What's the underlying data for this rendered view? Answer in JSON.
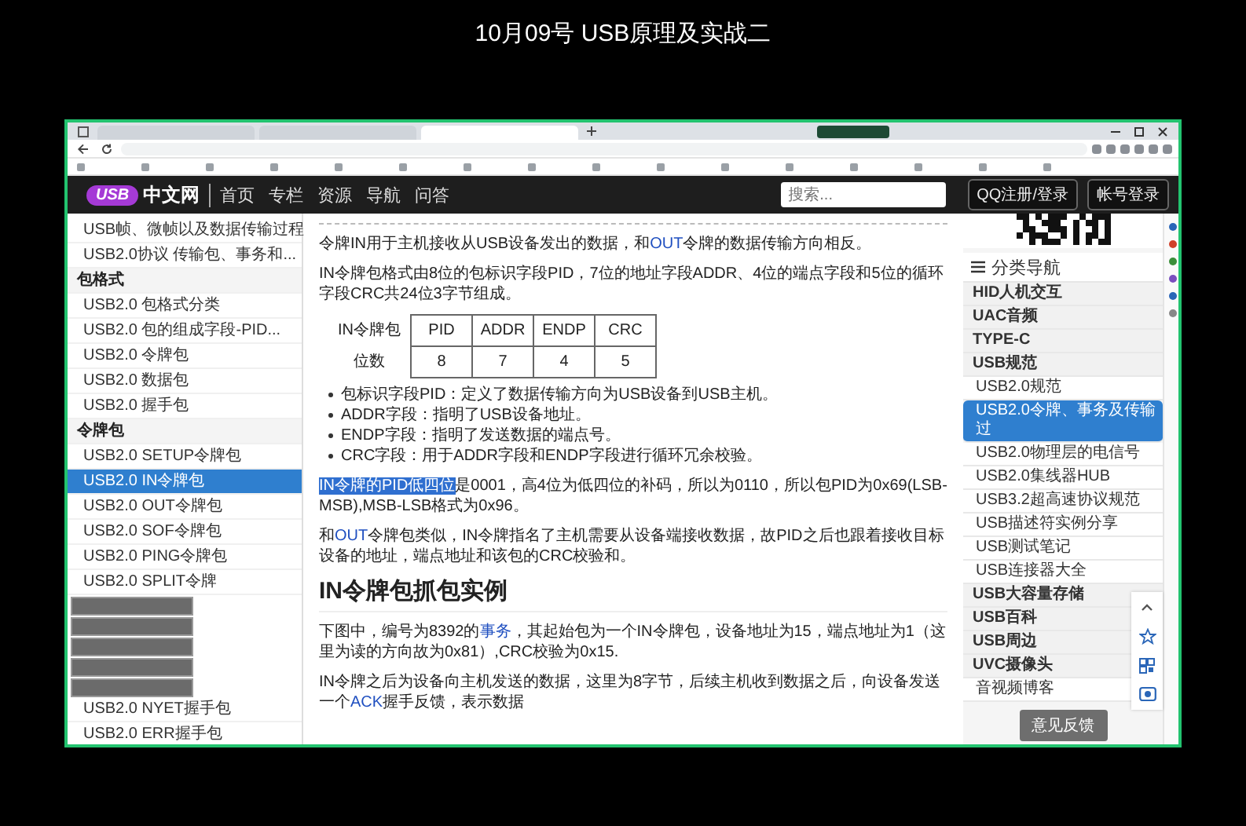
{
  "video_title": "10月09号 USB原理及实战二",
  "browser": {
    "tabs": [
      {
        "selected": false
      },
      {
        "selected": false
      },
      {
        "selected": true
      }
    ]
  },
  "site_nav": {
    "logo": {
      "badge": "USB",
      "name": "中文网"
    },
    "links": [
      "首页",
      "专栏",
      "资源",
      "导航",
      "问答"
    ],
    "search": {
      "placeholder": "搜索..."
    },
    "buttons": [
      "QQ注册/登录",
      "帐号登录"
    ]
  },
  "left_sidebar": {
    "items": [
      {
        "kind": "link",
        "label": "USB帧、微帧以及数据传输过程",
        "selected": false
      },
      {
        "kind": "link",
        "label": "USB2.0协议 传输包、事务和...",
        "selected": false
      },
      {
        "kind": "heading",
        "label": "包格式"
      },
      {
        "kind": "link",
        "label": "USB2.0 包格式分类",
        "selected": false
      },
      {
        "kind": "link",
        "label": "USB2.0 包的组成字段-PID...",
        "selected": false
      },
      {
        "kind": "link",
        "label": "USB2.0 令牌包",
        "selected": false
      },
      {
        "kind": "link",
        "label": "USB2.0 数据包",
        "selected": false
      },
      {
        "kind": "link",
        "label": "USB2.0 握手包",
        "selected": false
      },
      {
        "kind": "heading",
        "label": "令牌包"
      },
      {
        "kind": "link",
        "label": "USB2.0 SETUP令牌包",
        "selected": false
      },
      {
        "kind": "link",
        "label": "USB2.0 IN令牌包",
        "selected": true
      },
      {
        "kind": "link",
        "label": "USB2.0 OUT令牌包",
        "selected": false
      },
      {
        "kind": "link",
        "label": "USB2.0 SOF令牌包",
        "selected": false
      },
      {
        "kind": "link",
        "label": "USB2.0 PING令牌包",
        "selected": false
      },
      {
        "kind": "link",
        "label": "USB2.0 SPLIT令牌",
        "selected": false
      },
      {
        "kind": "overlay"
      },
      {
        "kind": "overlay"
      },
      {
        "kind": "overlay"
      },
      {
        "kind": "overlay"
      },
      {
        "kind": "overlay"
      },
      {
        "kind": "link",
        "label": "USB2.0 NYET握手包",
        "selected": false
      },
      {
        "kind": "link",
        "label": "USB2.0 ERR握手包",
        "selected": false
      }
    ]
  },
  "content": [
    {
      "kind": "paragraph",
      "runs": [
        {
          "kind": "plain",
          "text": "令牌IN用于主机接收从USB设备发出的数据，和"
        },
        {
          "kind": "link",
          "text": "OUT"
        },
        {
          "kind": "plain",
          "text": "令牌的数据传输方向相反。"
        }
      ]
    },
    {
      "kind": "paragraph",
      "runs": [
        {
          "kind": "plain",
          "text": "IN令牌包格式由8位的包标识字段PID，7位的地址字段ADDR、4位的端点字段和5位的循环字段CRC共24位3字节组成。"
        }
      ]
    },
    {
      "kind": "table",
      "rows": [
        [
          "IN令牌包",
          "PID",
          "ADDR",
          "ENDP",
          "CRC"
        ],
        [
          "位数",
          "8",
          "7",
          "4",
          "5"
        ]
      ]
    },
    {
      "kind": "bullets",
      "items": [
        "包标识字段PID：定义了数据传输方向为USB设备到USB主机。",
        "ADDR字段：指明了USB设备地址。",
        "ENDP字段：指明了发送数据的端点号。",
        "CRC字段：用于ADDR字段和ENDP字段进行循环冗余校验。"
      ]
    },
    {
      "kind": "paragraph",
      "runs": [
        {
          "kind": "selection",
          "text": "IN令牌的PID低四位"
        },
        {
          "kind": "plain",
          "text": "是0001，高4位为低四位的补码，所以为0110，所以包PID为0x69(LSB-MSB),MSB-LSB格式为0x96。"
        }
      ]
    },
    {
      "kind": "paragraph",
      "runs": [
        {
          "kind": "plain",
          "text": "和"
        },
        {
          "kind": "link",
          "text": "OUT"
        },
        {
          "kind": "plain",
          "text": "令牌包类似，IN令牌指名了主机需要从设备端接收数据，故PID之后也跟着接收目标设备的地址，端点地址和该包的CRC校验和。"
        }
      ]
    },
    {
      "kind": "heading",
      "text": "IN令牌包抓包实例"
    },
    {
      "kind": "paragraph",
      "runs": [
        {
          "kind": "plain",
          "text": "下图中，编号为8392的"
        },
        {
          "kind": "link",
          "text": "事务"
        },
        {
          "kind": "plain",
          "text": "，其起始包为一个IN令牌包，设备地址为15，端点地址为1（这里为读的方向故为0x81）,CRC校验为0x15."
        }
      ]
    },
    {
      "kind": "paragraph",
      "runs": [
        {
          "kind": "plain",
          "text": "IN令牌之后为设备向主机发送的数据，这里为8字节，后续主机收到数据之后，向设备发送一个"
        },
        {
          "kind": "link",
          "text": "ACK"
        },
        {
          "kind": "plain",
          "text": "握手反馈，表示数据"
        }
      ]
    }
  ],
  "right_sidebar": {
    "heading": "分类导航",
    "items": [
      {
        "kind": "category",
        "label": "HID人机交互",
        "selected": false
      },
      {
        "kind": "category",
        "label": "UAC音频",
        "selected": false
      },
      {
        "kind": "category",
        "label": "TYPE-C",
        "selected": false
      },
      {
        "kind": "category",
        "label": "USB规范",
        "selected": false
      },
      {
        "kind": "link",
        "label": "USB2.0规范",
        "selected": false
      },
      {
        "kind": "link",
        "label": "USB2.0令牌、事务及传输过",
        "selected": true
      },
      {
        "kind": "link",
        "label": "USB2.0物理层的电信号",
        "selected": false
      },
      {
        "kind": "link",
        "label": "USB2.0集线器HUB",
        "selected": false
      },
      {
        "kind": "link",
        "label": "USB3.2超高速协议规范",
        "selected": false
      },
      {
        "kind": "link",
        "label": "USB描述符实例分享",
        "selected": false
      },
      {
        "kind": "link",
        "label": "USB测试笔记",
        "selected": false
      },
      {
        "kind": "link",
        "label": "USB连接器大全",
        "selected": false
      },
      {
        "kind": "category",
        "label": "USB大容量存储",
        "selected": false
      },
      {
        "kind": "category",
        "label": "USB百科",
        "selected": false
      },
      {
        "kind": "category",
        "label": "USB周边",
        "selected": false
      },
      {
        "kind": "category",
        "label": "UVC摄像头",
        "selected": false
      },
      {
        "kind": "link",
        "label": "音视频博客",
        "selected": false
      }
    ],
    "feedback_button": "意见反馈"
  }
}
